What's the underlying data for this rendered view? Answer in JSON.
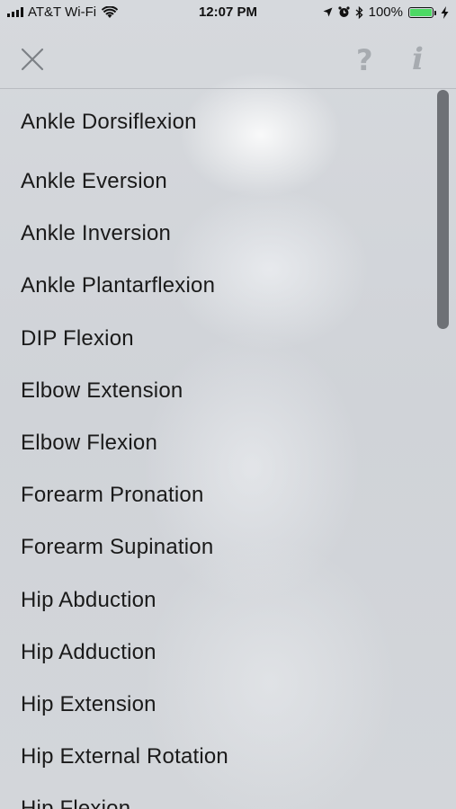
{
  "status_bar": {
    "carrier": "AT&T Wi-Fi",
    "time": "12:07 PM",
    "battery": "100%",
    "icons": [
      "signal-icon",
      "wifi-icon",
      "location-icon",
      "alarm-icon",
      "bluetooth-icon",
      "battery-icon",
      "charging-icon"
    ],
    "battery_color": "#4cd964"
  },
  "navbar": {
    "close_icon": "close-icon",
    "help_label": "?",
    "info_label": "i",
    "icon_color": "#a7abb0"
  },
  "list": {
    "items": [
      "Ankle Dorsiflexion",
      "Ankle Eversion",
      "Ankle Inversion",
      "Ankle Plantarflexion",
      "DIP Flexion",
      "Elbow Extension",
      "Elbow Flexion",
      "Forearm Pronation",
      "Forearm Supination",
      "Hip Abduction",
      "Hip Adduction",
      "Hip Extension",
      "Hip External Rotation",
      "Hip Flexion"
    ]
  }
}
